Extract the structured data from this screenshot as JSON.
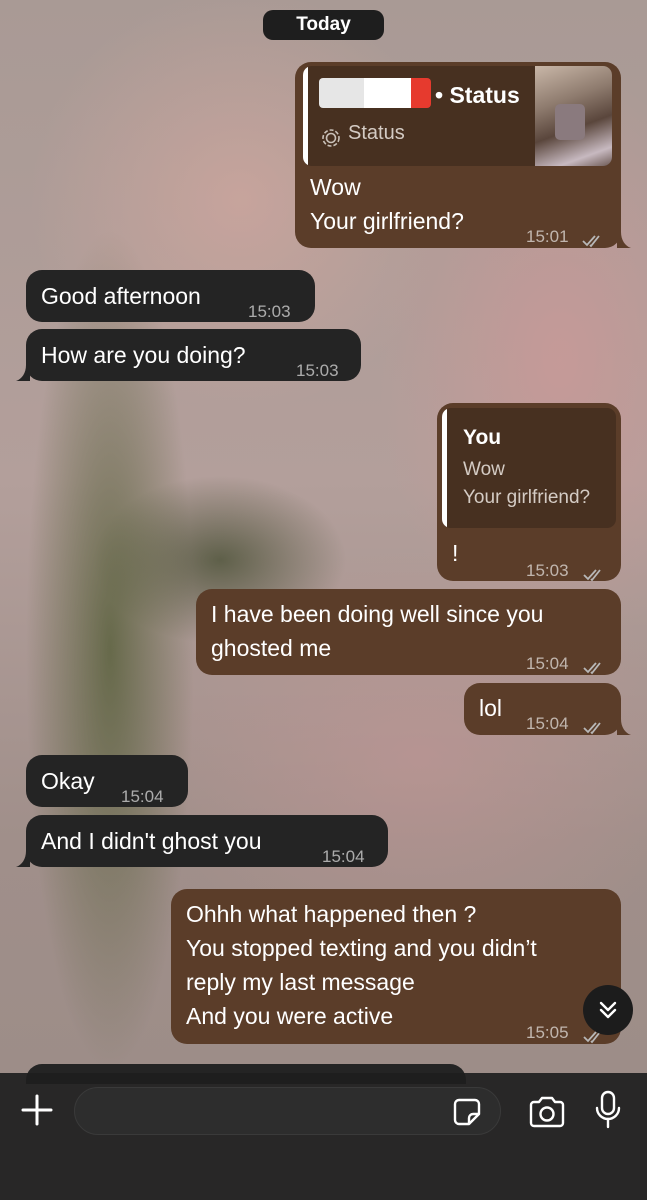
{
  "date_separator": "Today",
  "messages": [
    {
      "direction": "out",
      "reply_header": "• Status",
      "reply_sub": "Status",
      "lines": [
        "Wow",
        "Your girlfriend?"
      ],
      "time": "15:01",
      "status": "read"
    },
    {
      "direction": "in",
      "text": "Good afternoon",
      "time": "15:03"
    },
    {
      "direction": "in",
      "text": "How are you doing?",
      "time": "15:03"
    },
    {
      "direction": "out",
      "quote_author": "You",
      "quote_lines": [
        "Wow",
        "Your girlfriend?"
      ],
      "text": "!",
      "time": "15:03",
      "status": "read"
    },
    {
      "direction": "out",
      "lines": [
        "I have been doing well since  you",
        "ghosted me"
      ],
      "time": "15:04",
      "status": "read"
    },
    {
      "direction": "out",
      "text": "lol",
      "time": "15:04",
      "status": "read"
    },
    {
      "direction": "in",
      "text": "Okay",
      "time": "15:04"
    },
    {
      "direction": "in",
      "text": "And I didn't ghost you",
      "time": "15:04"
    },
    {
      "direction": "out",
      "lines": [
        "Ohhh what happened then ?",
        "You stopped texting and you didn’t",
        "reply my last message",
        "And you were active"
      ],
      "time": "15:05",
      "status": "read"
    }
  ],
  "composer": {
    "input_placeholder": "",
    "icons": [
      "plus-icon",
      "sticker-icon",
      "camera-icon",
      "microphone-icon"
    ]
  },
  "scroll_button_icon": "double-chevron-down-icon",
  "colors": {
    "incoming_bubble": "#242424",
    "outgoing_bubble": "#5b3d29",
    "quote_background": "#473020",
    "read_ticks": "#b8b8b8"
  }
}
